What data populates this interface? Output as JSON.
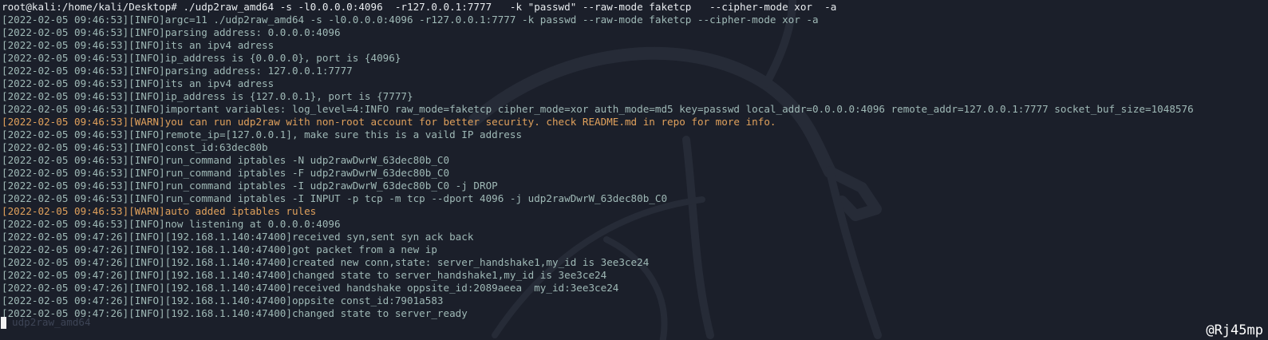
{
  "terminal": {
    "command": "root@kali:/home/kali/Desktop# ./udp2raw_amd64 -s -l0.0.0.0:4096  -r127.0.0.1:7777   -k \"passwd\" --raw-mode faketcp   --cipher-mode xor  -a",
    "log": [
      {
        "level": "info",
        "text": "[2022-02-05 09:46:53][INFO]argc=11 ./udp2raw_amd64 -s -l0.0.0.0:4096 -r127.0.0.1:7777 -k passwd --raw-mode faketcp --cipher-mode xor -a"
      },
      {
        "level": "info",
        "text": "[2022-02-05 09:46:53][INFO]parsing address: 0.0.0.0:4096"
      },
      {
        "level": "info",
        "text": "[2022-02-05 09:46:53][INFO]its an ipv4 adress"
      },
      {
        "level": "info",
        "text": "[2022-02-05 09:46:53][INFO]ip_address is {0.0.0.0}, port is {4096}"
      },
      {
        "level": "info",
        "text": "[2022-02-05 09:46:53][INFO]parsing address: 127.0.0.1:7777"
      },
      {
        "level": "info",
        "text": "[2022-02-05 09:46:53][INFO]its an ipv4 adress"
      },
      {
        "level": "info",
        "text": "[2022-02-05 09:46:53][INFO]ip_address is {127.0.0.1}, port is {7777}"
      },
      {
        "level": "info",
        "text": "[2022-02-05 09:46:53][INFO]important variables: log_level=4:INFO raw_mode=faketcp cipher_mode=xor auth_mode=md5 key=passwd local_addr=0.0.0.0:4096 remote_addr=127.0.0.1:7777 socket_buf_size=1048576"
      },
      {
        "level": "warn",
        "text": "[2022-02-05 09:46:53][WARN]you can run udp2raw with non-root account for better security. check README.md in repo for more info."
      },
      {
        "level": "info",
        "text": "[2022-02-05 09:46:53][INFO]remote_ip=[127.0.0.1], make sure this is a vaild IP address"
      },
      {
        "level": "info",
        "text": "[2022-02-05 09:46:53][INFO]const_id:63dec80b"
      },
      {
        "level": "info",
        "text": "[2022-02-05 09:46:53][INFO]run_command iptables -N udp2rawDwrW_63dec80b_C0"
      },
      {
        "level": "info",
        "text": "[2022-02-05 09:46:53][INFO]run_command iptables -F udp2rawDwrW_63dec80b_C0"
      },
      {
        "level": "info",
        "text": "[2022-02-05 09:46:53][INFO]run_command iptables -I udp2rawDwrW_63dec80b_C0 -j DROP"
      },
      {
        "level": "info",
        "text": "[2022-02-05 09:46:53][INFO]run_command iptables -I INPUT -p tcp -m tcp --dport 4096 -j udp2rawDwrW_63dec80b_C0"
      },
      {
        "level": "warn",
        "text": "[2022-02-05 09:46:53][WARN]auto added iptables rules"
      },
      {
        "level": "info",
        "text": "[2022-02-05 09:46:53][INFO]now listening at 0.0.0.0:4096"
      },
      {
        "level": "info",
        "text": "[2022-02-05 09:47:26][INFO][192.168.1.140:47400]received syn,sent syn ack back"
      },
      {
        "level": "info",
        "text": "[2022-02-05 09:47:26][INFO][192.168.1.140:47400]got packet from a new ip"
      },
      {
        "level": "info",
        "text": "[2022-02-05 09:47:26][INFO][192.168.1.140:47400]created new conn,state: server_handshake1,my_id is 3ee3ce24"
      },
      {
        "level": "info",
        "text": "[2022-02-05 09:47:26][INFO][192.168.1.140:47400]changed state to server_handshake1,my_id is 3ee3ce24"
      },
      {
        "level": "info",
        "text": "[2022-02-05 09:47:26][INFO][192.168.1.140:47400]received handshake oppsite_id:2089aeea  my_id:3ee3ce24"
      },
      {
        "level": "info",
        "text": "[2022-02-05 09:47:26][INFO][192.168.1.140:47400]oppsite const_id:7901a583"
      },
      {
        "level": "info",
        "text": "[2022-02-05 09:47:26][INFO][192.168.1.140:47400]changed state to server_ready"
      }
    ],
    "ghost_text": "udp2raw_amd64",
    "watermark": "@Rj45mp"
  },
  "colors": {
    "background": "#1b1f2a",
    "info_text": "#9fb9b6",
    "warn_text": "#e0a15c",
    "command_text": "#e8ecef"
  },
  "icons": {
    "background_logo": "kali-dragon-icon",
    "cursor": "block-cursor"
  }
}
